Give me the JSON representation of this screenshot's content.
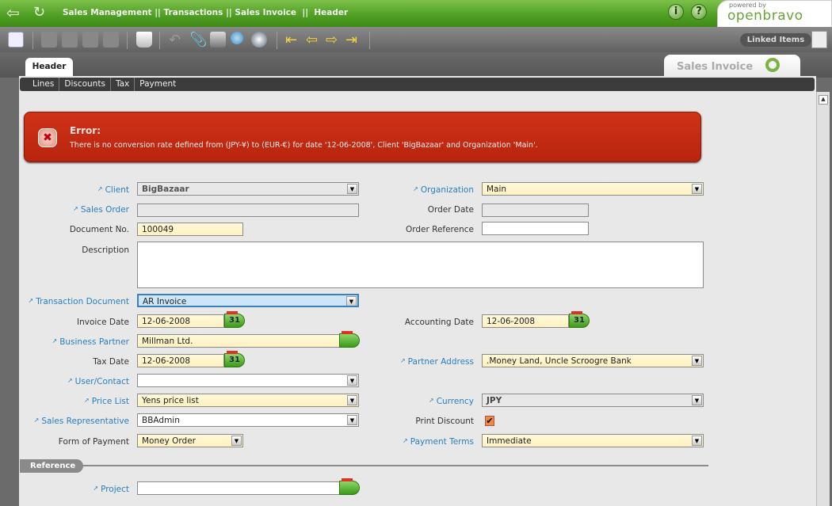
{
  "header": {
    "breadcrumb": "Sales Management || Transactions || Sales Invoice  ||  Header",
    "info_label": "i",
    "help_label": "?",
    "logo_small": "powered by",
    "logo_text": "openbravo"
  },
  "toolbar": {
    "linked_items": "Linked Items"
  },
  "tabs": {
    "active": "Header",
    "window": "Sales Invoice",
    "subtabs": [
      "Lines",
      "Discounts",
      "Tax",
      "Payment"
    ]
  },
  "error": {
    "title": "Error:",
    "message": "There is no conversion rate defined from (JPY-¥) to (EUR-€) for date '12-06-2008', Client 'BigBazaar' and Organization 'Main'."
  },
  "form": {
    "client": {
      "label": "Client",
      "value": "BigBazaar"
    },
    "organization": {
      "label": "Organization",
      "value": "Main"
    },
    "sales_order": {
      "label": "Sales Order",
      "value": ""
    },
    "order_date": {
      "label": "Order Date",
      "value": ""
    },
    "document_no": {
      "label": "Document No.",
      "value": "100049"
    },
    "order_reference": {
      "label": "Order Reference",
      "value": ""
    },
    "description": {
      "label": "Description",
      "value": ""
    },
    "transaction_document": {
      "label": "Transaction Document",
      "value": "AR Invoice"
    },
    "invoice_date": {
      "label": "Invoice Date",
      "value": "12-06-2008"
    },
    "accounting_date": {
      "label": "Accounting Date",
      "value": "12-06-2008"
    },
    "business_partner": {
      "label": "Business Partner",
      "value": "Millman Ltd."
    },
    "tax_date": {
      "label": "Tax Date",
      "value": "12-06-2008"
    },
    "partner_address": {
      "label": "Partner Address",
      "value": ".Money Land, Uncle Scroogre Bank"
    },
    "user_contact": {
      "label": "User/Contact",
      "value": ""
    },
    "price_list": {
      "label": "Price List",
      "value": "Yens price list"
    },
    "currency": {
      "label": "Currency",
      "value": "JPY"
    },
    "sales_rep": {
      "label": "Sales Representative",
      "value": "BBAdmin"
    },
    "print_discount": {
      "label": "Print Discount",
      "checked": true
    },
    "form_of_payment": {
      "label": "Form of Payment",
      "value": "Money Order"
    },
    "payment_terms": {
      "label": "Payment Terms",
      "value": "Immediate"
    },
    "section_reference": "Reference",
    "project": {
      "label": "Project",
      "value": ""
    },
    "calendar_day": "31"
  }
}
